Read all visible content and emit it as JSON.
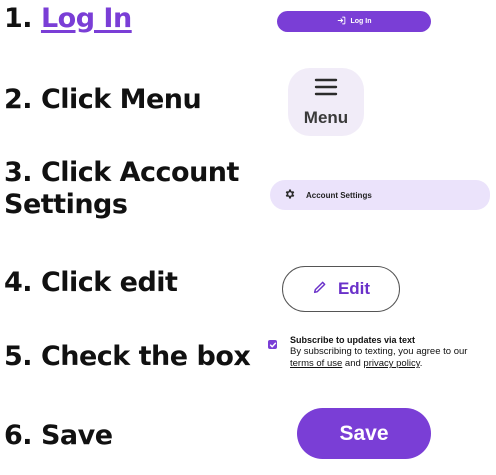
{
  "steps": {
    "s1_num": "1.",
    "s1_link": "Log In",
    "s2": "2. Click Menu",
    "s3_line1": "3. Click Account",
    "s3_line2": "Settings",
    "s4": "4. Click edit",
    "s5": "5. Check the box",
    "s6": "6. Save"
  },
  "login_button": {
    "label": "Log In",
    "icon": "login-arrow-icon"
  },
  "menu_button": {
    "label": "Menu",
    "icon": "hamburger-icon"
  },
  "account_settings": {
    "label": "Account Settings",
    "icon": "gear-icon"
  },
  "edit_button": {
    "label": "Edit",
    "icon": "pencil-icon"
  },
  "subscribe": {
    "checked": true,
    "title": "Subscribe to updates via text",
    "text_before": "By subscribing to texting, you agree to our",
    "terms_link": "terms of use",
    "and": "and",
    "privacy_link": "privacy policy",
    "period": "."
  },
  "save_button": {
    "label": "Save"
  },
  "colors": {
    "accent": "#7a3ed6",
    "menu_bg": "#f1ecf8",
    "account_bg": "#ebe3fb"
  }
}
